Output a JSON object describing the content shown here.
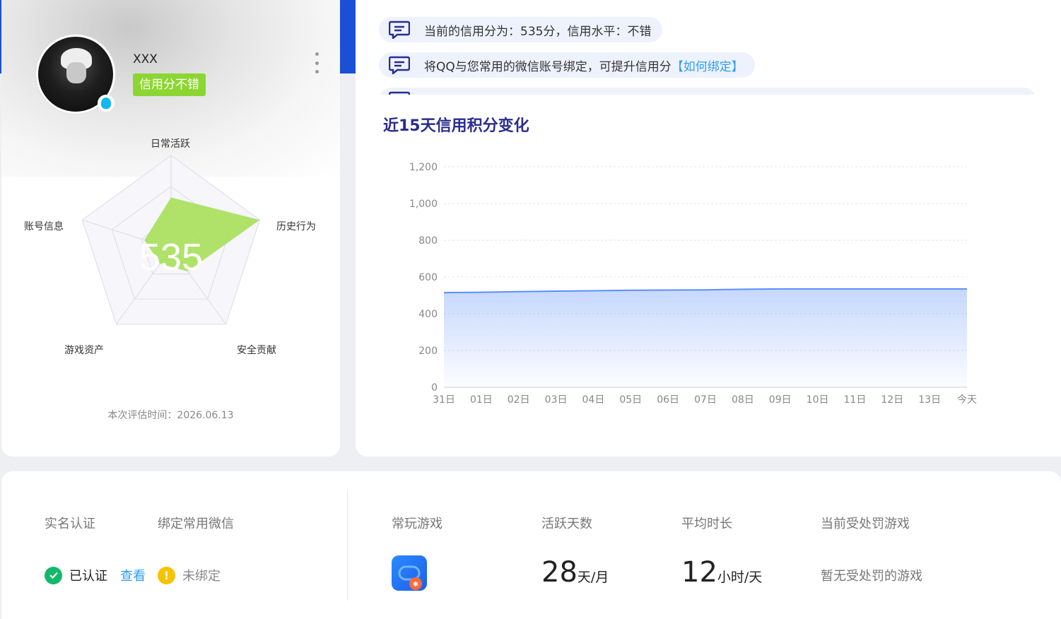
{
  "profile": {
    "nickname": "XXX",
    "credit_tag": "信用分不错",
    "radar": {
      "score_text": "535",
      "axes": [
        "日常活跃",
        "历史行为",
        "安全贡献",
        "游戏资产",
        "账号信息"
      ],
      "levels": [
        0.55,
        1.0,
        0.3,
        0.2,
        0.3
      ],
      "eval_time": "本次评估时间：2026.06.13"
    }
  },
  "messages": [
    {
      "text": "当前的信用分为：535分，信用水平：不错",
      "link": ""
    },
    {
      "text": "将QQ与您常用的微信账号绑定，可提升信用分",
      "link": "【如何绑定】"
    }
  ],
  "chart_data": {
    "type": "area",
    "title": "近15天信用积分变化",
    "categories": [
      "31日",
      "01日",
      "02日",
      "03日",
      "04日",
      "05日",
      "06日",
      "07日",
      "08日",
      "09日",
      "10日",
      "11日",
      "12日",
      "13日",
      "今天"
    ],
    "values": [
      515,
      517,
      520,
      523,
      525,
      528,
      529,
      530,
      533,
      535,
      535,
      535,
      535,
      535,
      535
    ],
    "ylim": [
      0,
      1200
    ],
    "yticks": [
      0,
      200,
      400,
      600,
      800,
      1000,
      1200
    ],
    "ytick_labels": [
      "0",
      "200",
      "400",
      "600",
      "800",
      "1,000",
      "1,200"
    ],
    "grid": true,
    "color": "#5b8ff9"
  },
  "bottom": {
    "real_name_label": "实名认证",
    "wechat_label": "绑定常用微信",
    "verified_text": "已认证",
    "view_link": "查看",
    "unbound_text": "未绑定",
    "frequent_game_label": "常玩游戏",
    "active_days_label": "活跃天数",
    "active_days_value": "28",
    "active_days_unit": "天/月",
    "avg_duration_label": "平均时长",
    "avg_duration_value": "12",
    "avg_duration_unit": "小时/天",
    "punished_label": "当前受处罚游戏",
    "punished_value": "暂无受处罚的游戏"
  },
  "colors": {
    "accent_blue": "#1b4fd6",
    "tag_green": "#8cd632",
    "link": "#2f9df0",
    "ok": "#14b86a",
    "warn": "#f7c300"
  }
}
